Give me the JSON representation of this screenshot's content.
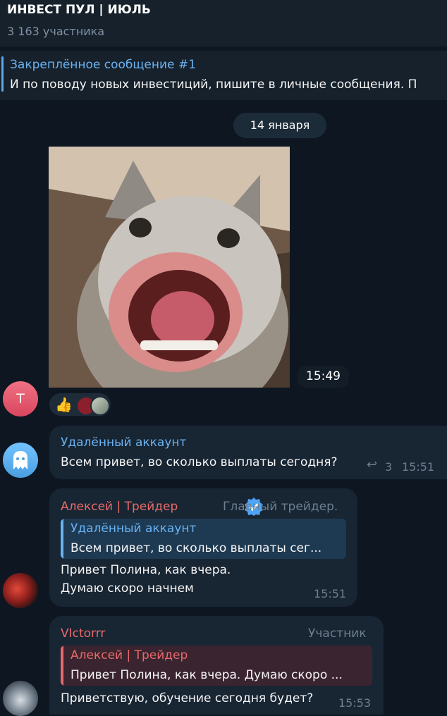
{
  "header": {
    "title": "ИНВЕСТ ПУЛ | ИЮЛЬ",
    "subtitle": "3 163 участника"
  },
  "pinned": {
    "title": "Закреплённое сообщение #1",
    "text": "И по поводу новых инвестиций, пишите в личные сообщения. П"
  },
  "date_pill": "14 января",
  "photo_message": {
    "time": "15:49",
    "avatar_letter": "Т"
  },
  "reactions": {
    "emoji": "👍"
  },
  "messages": [
    {
      "author": "Удалённый аккаунт",
      "text": "Всем привет, во сколько выплаты сегодня?",
      "reply_count": "3",
      "time": "15:51"
    },
    {
      "author": "Алексей | Трейдер",
      "role": "Главный трейдер.",
      "quote_author": "Удалённый аккаунт",
      "quote_text": "Всем привет, во сколько выплаты сег...",
      "text_line1": "Привет Полина, как вчера.",
      "text_line2": "Думаю скоро начнем",
      "time": "15:51"
    },
    {
      "author": "VIctorrr",
      "role": "Участник",
      "quote_author": "Алексей | Трейдер",
      "quote_text": "Привет Полина, как вчера. Думаю скоро ...",
      "text": "Приветствую, обучение сегодня будет?",
      "time": "15:53"
    }
  ],
  "colors": {
    "background": "#0e1621",
    "bubble": "#182533",
    "accent_blue": "#6ab3f3",
    "author_red": "#e76a6a"
  }
}
